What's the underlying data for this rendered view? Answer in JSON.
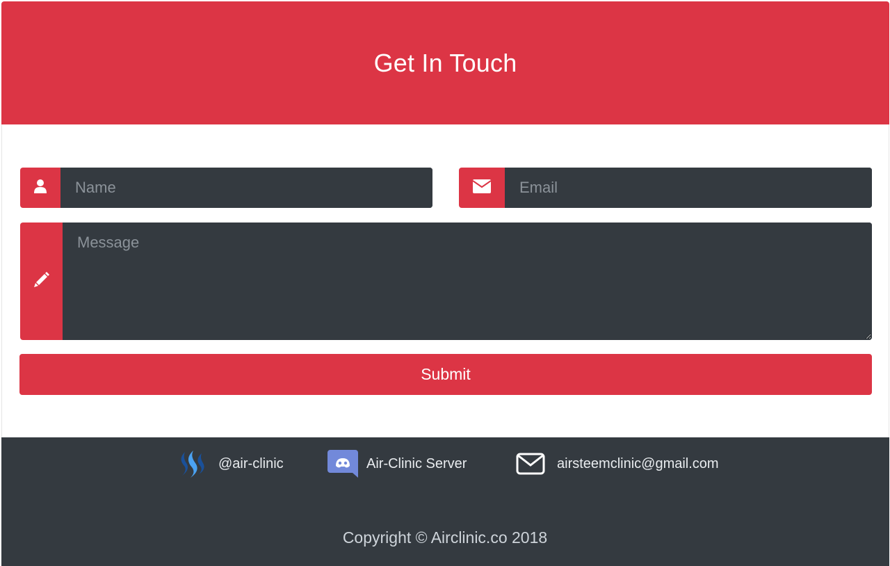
{
  "header": {
    "title": "Get In Touch",
    "background_color": "#dc3545"
  },
  "form": {
    "name": {
      "placeholder": "Name",
      "value": "",
      "icon": "user-icon"
    },
    "email": {
      "placeholder": "Email",
      "value": "",
      "icon": "envelope-icon"
    },
    "message": {
      "placeholder": "Message",
      "value": "",
      "icon": "pencil-icon"
    },
    "submit_label": "Submit",
    "field_color": "#343a40",
    "accent_color": "#dc3545"
  },
  "footer": {
    "links": [
      {
        "label": "@air-clinic",
        "icon": "steem-icon"
      },
      {
        "label": "Air-Clinic Server",
        "icon": "discord-icon"
      },
      {
        "label": "airsteemclinic@gmail.com",
        "icon": "mail-icon"
      }
    ],
    "copyright": "Copyright © Airclinic.co 2018",
    "background_color": "#343a40"
  }
}
